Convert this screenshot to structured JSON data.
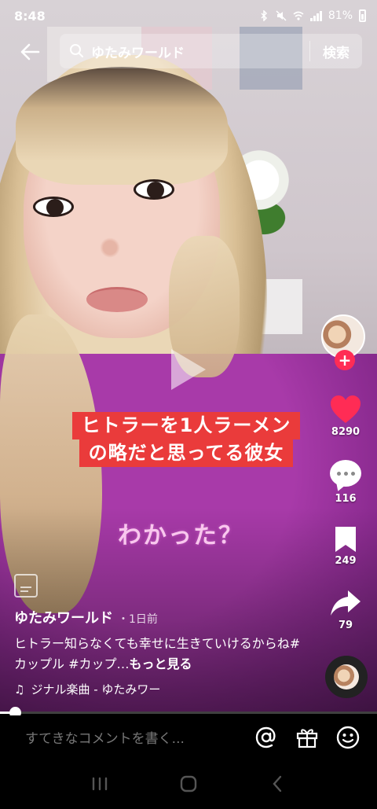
{
  "status_bar": {
    "time": "8:48",
    "battery": "81%"
  },
  "search": {
    "query": "ゆたみワールド",
    "button_label": "検索"
  },
  "caption": {
    "line1": "ヒトラーを1人ラーメン",
    "line2": "の略だと思ってる彼女",
    "subtext": "わかった？"
  },
  "rail": {
    "likes": "8290",
    "comments": "116",
    "bookmarks": "249",
    "shares": "79"
  },
  "post": {
    "author": "ゆたみワールド",
    "date": "・1日前",
    "description": "ヒトラー知らなくても幸せに生きていけるからね#カップル #カップ…",
    "more_label": "もっと見る",
    "music": "ジナル楽曲 - ゆたみワー"
  },
  "playback": {
    "progress_fraction": 0.04
  },
  "comment_bar": {
    "placeholder": "すてきなコメントを書く..."
  },
  "colors": {
    "like": "#ff2c55",
    "caption_bg": "#ea3b3b",
    "subtext": "#f9c7ee"
  }
}
